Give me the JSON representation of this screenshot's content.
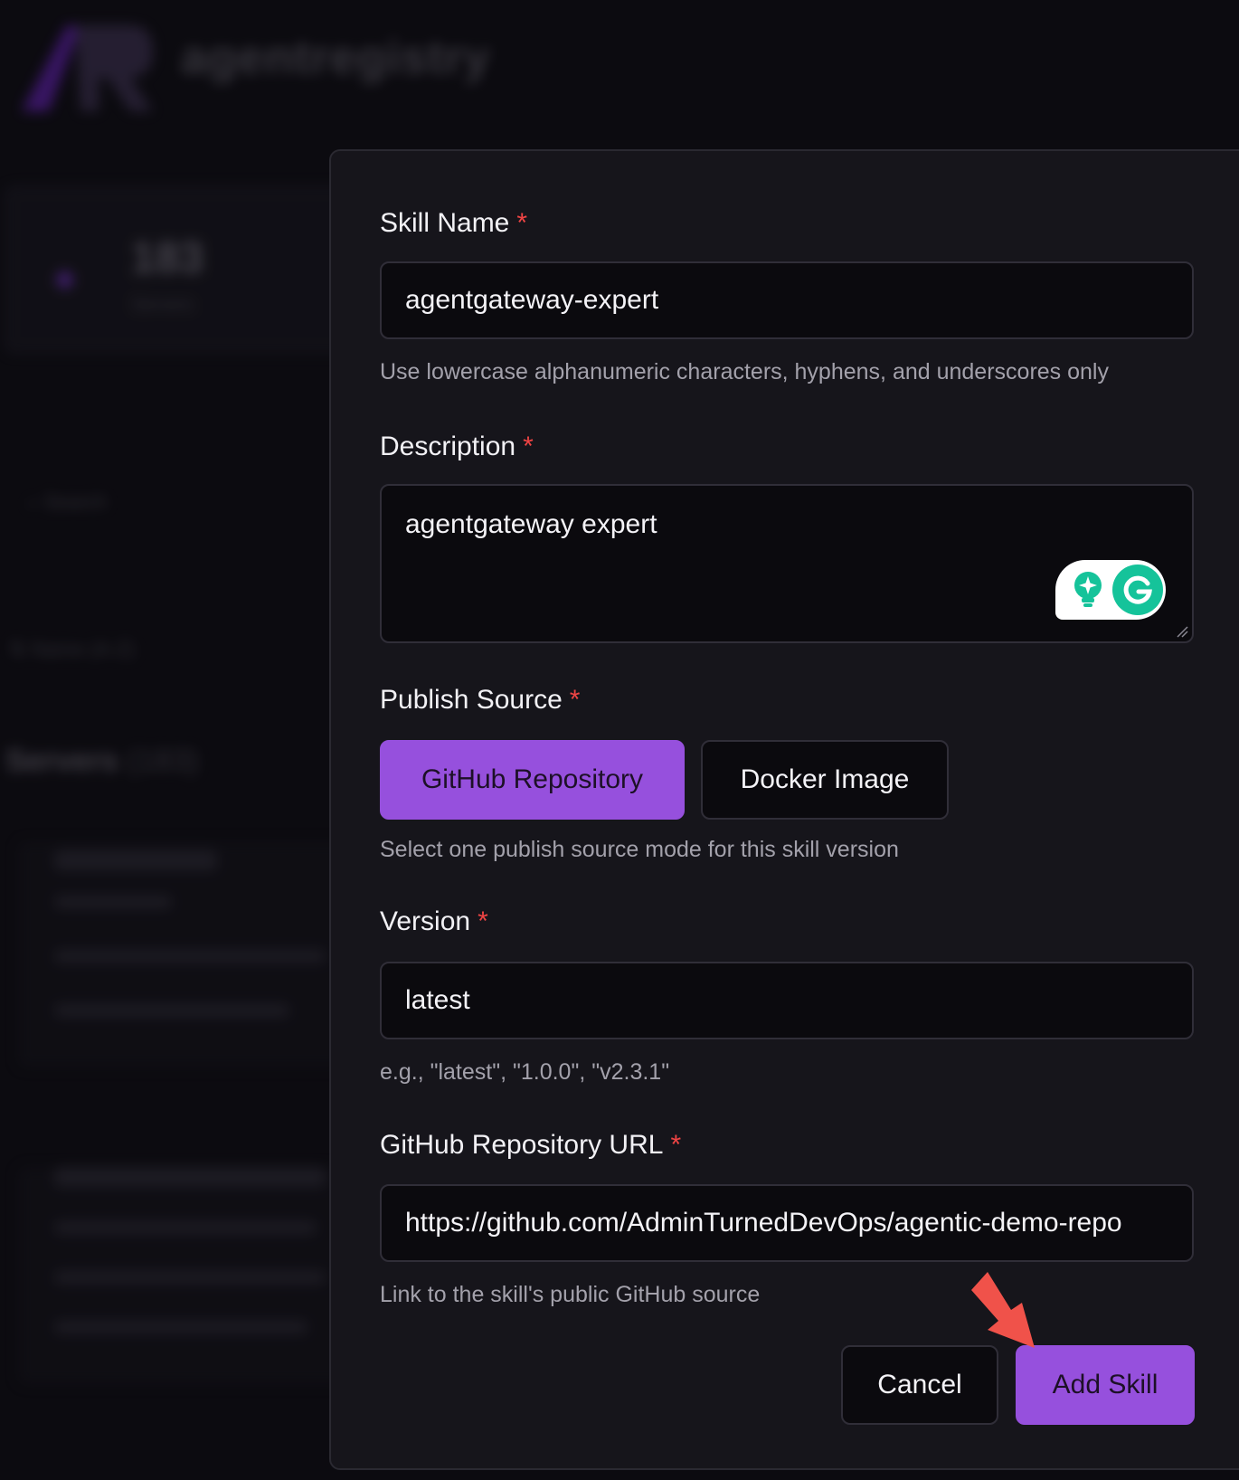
{
  "background": {
    "wordmark": "agentregistry",
    "stat_value": "183",
    "stat_label": "Servers",
    "search_placeholder": "Search",
    "sort_label": "Name (A-Z)",
    "section_title": "Servers",
    "section_count": "(183)"
  },
  "form": {
    "skill_name": {
      "label": "Skill Name",
      "required_mark": "*",
      "value": "agentgateway-expert",
      "hint": "Use lowercase alphanumeric characters, hyphens, and underscores only"
    },
    "description": {
      "label": "Description",
      "required_mark": "*",
      "value": "agentgateway expert"
    },
    "publish_source": {
      "label": "Publish Source",
      "required_mark": "*",
      "options": [
        "GitHub Repository",
        "Docker Image"
      ],
      "selected": "GitHub Repository",
      "hint": "Select one publish source mode for this skill version"
    },
    "version": {
      "label": "Version",
      "required_mark": "*",
      "value": "latest",
      "hint": "e.g., \"latest\", \"1.0.0\", \"v2.3.1\""
    },
    "github_url": {
      "label": "GitHub Repository URL",
      "required_mark": "*",
      "value": "https://github.com/AdminTurnedDevOps/agentic-demo-repo",
      "hint": "Link to the skill's public GitHub source"
    },
    "actions": {
      "cancel_label": "Cancel",
      "submit_label": "Add Skill"
    }
  },
  "colors": {
    "accent": "#9650dd",
    "required": "#ef4444",
    "annotation_arrow": "#f0524a",
    "grammarly_green": "#15c39a"
  },
  "icons": {
    "grammarly": "grammarly-icon",
    "lightbulb": "lightbulb-icon",
    "annotation": "arrow-annotation-icon"
  }
}
